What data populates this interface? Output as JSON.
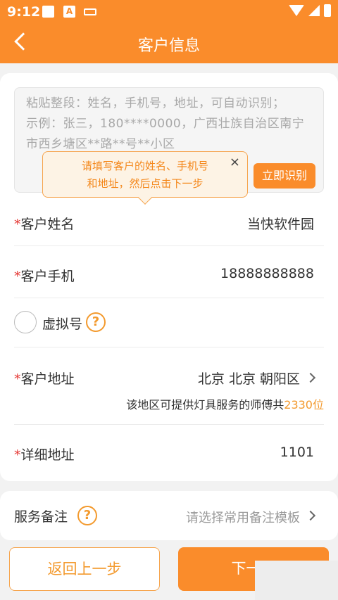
{
  "status_bar": {
    "time": "9:12",
    "notif_letter": "A"
  },
  "header": {
    "title": "客户信息"
  },
  "paste_box": {
    "placeholder": "粘贴整段：姓名，手机号，地址，可自动识别；\n示例：张三，180****0000，广西壮族自治区南宁市西乡塘区**路**号**小区",
    "recognize_label": "立即识别"
  },
  "tooltip": {
    "line1": "请填写客户的姓名、手机号",
    "line2": "和地址，然后点击下一步",
    "close": "×"
  },
  "form": {
    "required_mark": "*",
    "name": {
      "label": "客户姓名",
      "value": "当快软件园"
    },
    "phone": {
      "label": "客户手机",
      "value": "18888888888"
    },
    "virtual": {
      "label": "虚拟号",
      "help": "?"
    },
    "address": {
      "label": "客户地址",
      "value": "北京 北京 朝阳区",
      "hint_prefix": "该地区可提供灯具服务的师傅共",
      "hint_count": "2330位"
    },
    "detail": {
      "label": "详细地址",
      "value": "1101"
    }
  },
  "remark": {
    "label": "服务备注",
    "help": "?",
    "value": "请选择常用备注模板"
  },
  "buttons": {
    "back": "返回上一步",
    "next": "下一步"
  },
  "colors": {
    "accent": "#fa8c2b",
    "required": "#e53935",
    "highlight": "#f39a2e"
  }
}
